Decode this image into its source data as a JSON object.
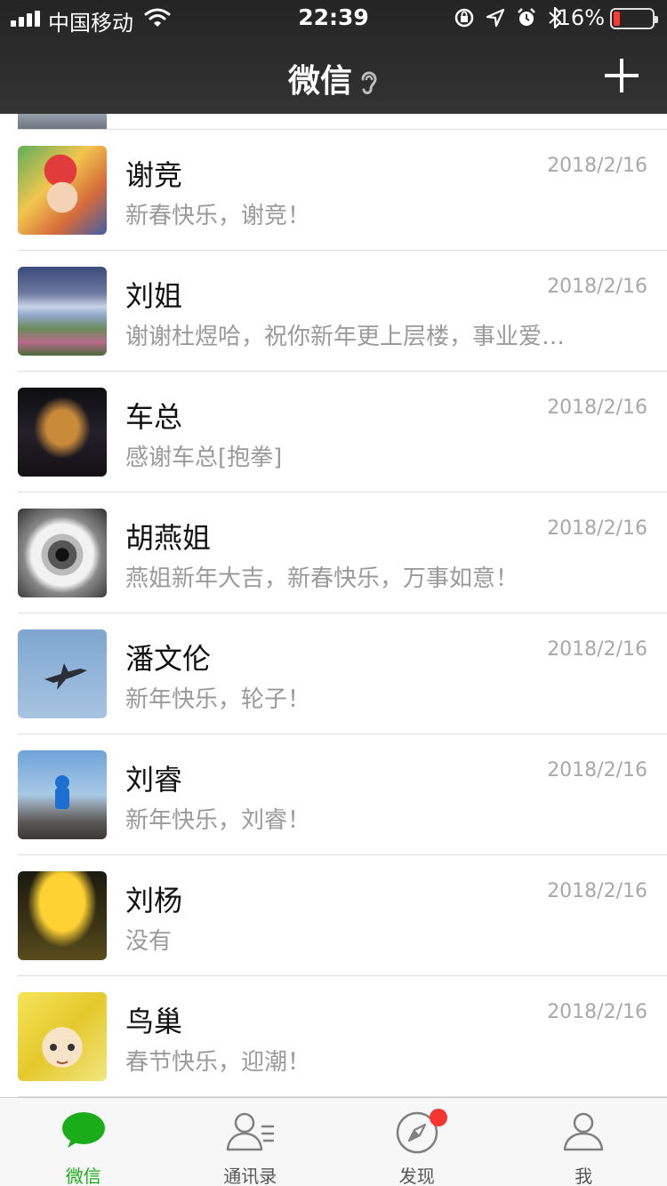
{
  "status_bar": {
    "carrier": "中国移动",
    "time": "22:39",
    "battery_percent": "16%",
    "battery_level": 0.16,
    "battery_color": "#ff3b30",
    "icons": [
      "signal-icon",
      "wifi-icon",
      "rotation-lock-icon",
      "location-icon",
      "alarm-icon",
      "bluetooth-icon",
      "battery-icon"
    ]
  },
  "nav": {
    "title": "微信",
    "ear_icon": "earpiece-mode-icon",
    "add_icon": "plus-icon"
  },
  "chats": [
    {
      "name": "谢竞",
      "message": "新春快乐，谢竞！",
      "time": "2018/2/16"
    },
    {
      "name": "刘姐",
      "message": "谢谢杜煜哈，祝你新年更上层楼，事业爱…",
      "time": "2018/2/16"
    },
    {
      "name": "车总",
      "message": "感谢车总[抱拳]",
      "time": "2018/2/16"
    },
    {
      "name": "胡燕姐",
      "message": "燕姐新年大吉，新春快乐，万事如意！",
      "time": "2018/2/16"
    },
    {
      "name": "潘文伦",
      "message": "新年快乐，轮子！",
      "time": "2018/2/16"
    },
    {
      "name": "刘睿",
      "message": "新年快乐，刘睿！",
      "time": "2018/2/16"
    },
    {
      "name": "刘杨",
      "message": "没有",
      "time": "2018/2/16"
    },
    {
      "name": "鸟巢",
      "message": "春节快乐，迎潮！",
      "time": "2018/2/16"
    }
  ],
  "tabbar": {
    "tabs": [
      {
        "label": "微信",
        "icon": "chat-bubble-icon",
        "active": true
      },
      {
        "label": "通讯录",
        "icon": "contacts-icon",
        "active": false
      },
      {
        "label": "发现",
        "icon": "compass-icon",
        "active": false,
        "badge": "red-dot"
      },
      {
        "label": "我",
        "icon": "profile-icon",
        "active": false
      }
    ],
    "active_color": "#1aad19"
  }
}
